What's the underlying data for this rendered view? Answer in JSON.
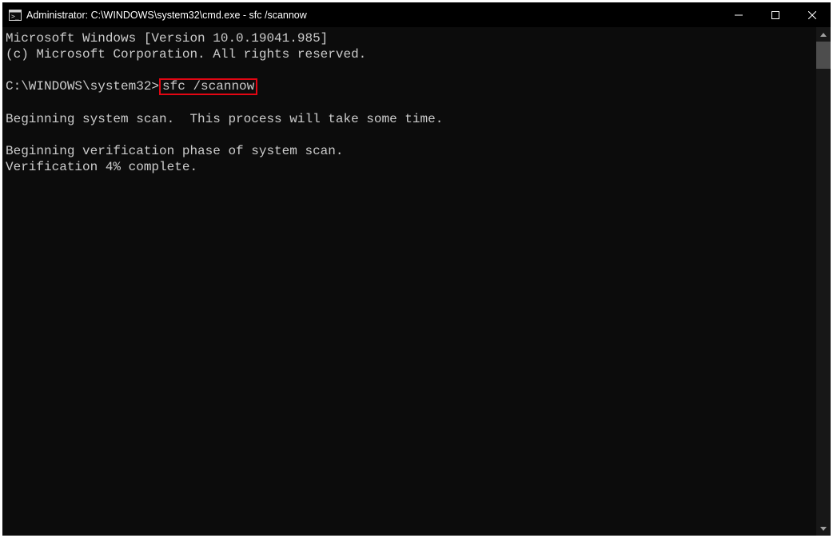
{
  "titlebar": {
    "title": "Administrator: C:\\WINDOWS\\system32\\cmd.exe - sfc  /scannow"
  },
  "terminal": {
    "line1": "Microsoft Windows [Version 10.0.19041.985]",
    "line2": "(c) Microsoft Corporation. All rights reserved.",
    "blank": "",
    "prompt": "C:\\WINDOWS\\system32>",
    "command": "sfc /scannow",
    "scan1": "Beginning system scan.  This process will take some time.",
    "scan2": "Beginning verification phase of system scan.",
    "scan3": "Verification 4% complete."
  }
}
